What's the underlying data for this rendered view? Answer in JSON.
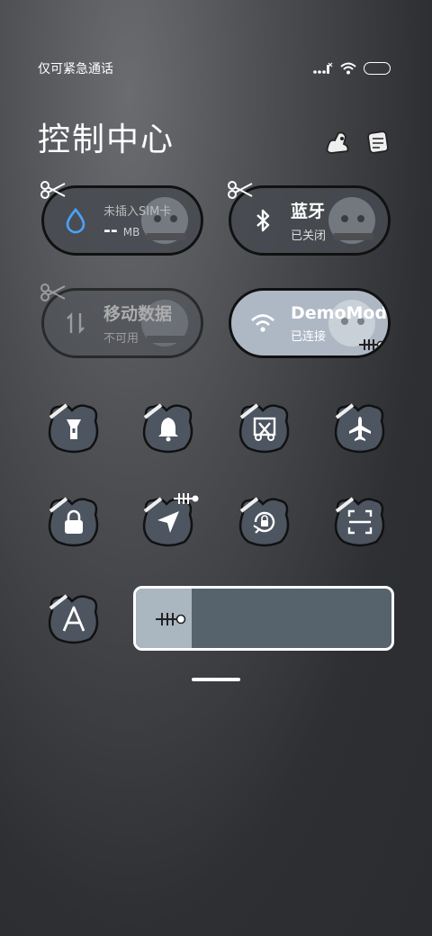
{
  "status_bar": {
    "carrier_text": "仅可紧急通话",
    "icons": [
      "signal-icon",
      "wifi-icon",
      "battery-icon"
    ]
  },
  "header": {
    "title": "控制中心",
    "icons": [
      "edit-icon",
      "settings-icon"
    ]
  },
  "big_tiles": {
    "data_usage": {
      "main": "--",
      "unit": "MB",
      "sub": "未插入SIM卡",
      "icon": "water-drop-icon"
    },
    "bluetooth": {
      "main": "蓝牙",
      "sub": "已关闭",
      "icon": "bluetooth-icon"
    },
    "mobile_data": {
      "main": "移动数据",
      "sub": "不可用",
      "icon": "mobile-data-icon"
    },
    "wifi": {
      "main": "DemoMod",
      "sub": "已连接",
      "icon": "wifi-icon"
    }
  },
  "round_tiles": [
    {
      "name": "flashlight",
      "icon": "flashlight-icon"
    },
    {
      "name": "ringer",
      "icon": "bell-icon"
    },
    {
      "name": "screenshot",
      "icon": "screenshot-icon"
    },
    {
      "name": "airplane-mode",
      "icon": "airplane-icon"
    },
    {
      "name": "lock-screen",
      "icon": "lock-icon"
    },
    {
      "name": "location",
      "icon": "location-icon"
    },
    {
      "name": "auto-rotate",
      "icon": "rotate-icon"
    },
    {
      "name": "scanner",
      "icon": "scan-icon"
    },
    {
      "name": "auto-brightness",
      "icon": "auto-brightness-icon"
    }
  ],
  "brightness": {
    "level_percent": 22,
    "icon": "fish-bone-icon"
  },
  "colors": {
    "tile_dark": "#4a4e54",
    "tile_wifi_active": "#aeb8c5",
    "accent_blue": "#4aa3ff"
  }
}
